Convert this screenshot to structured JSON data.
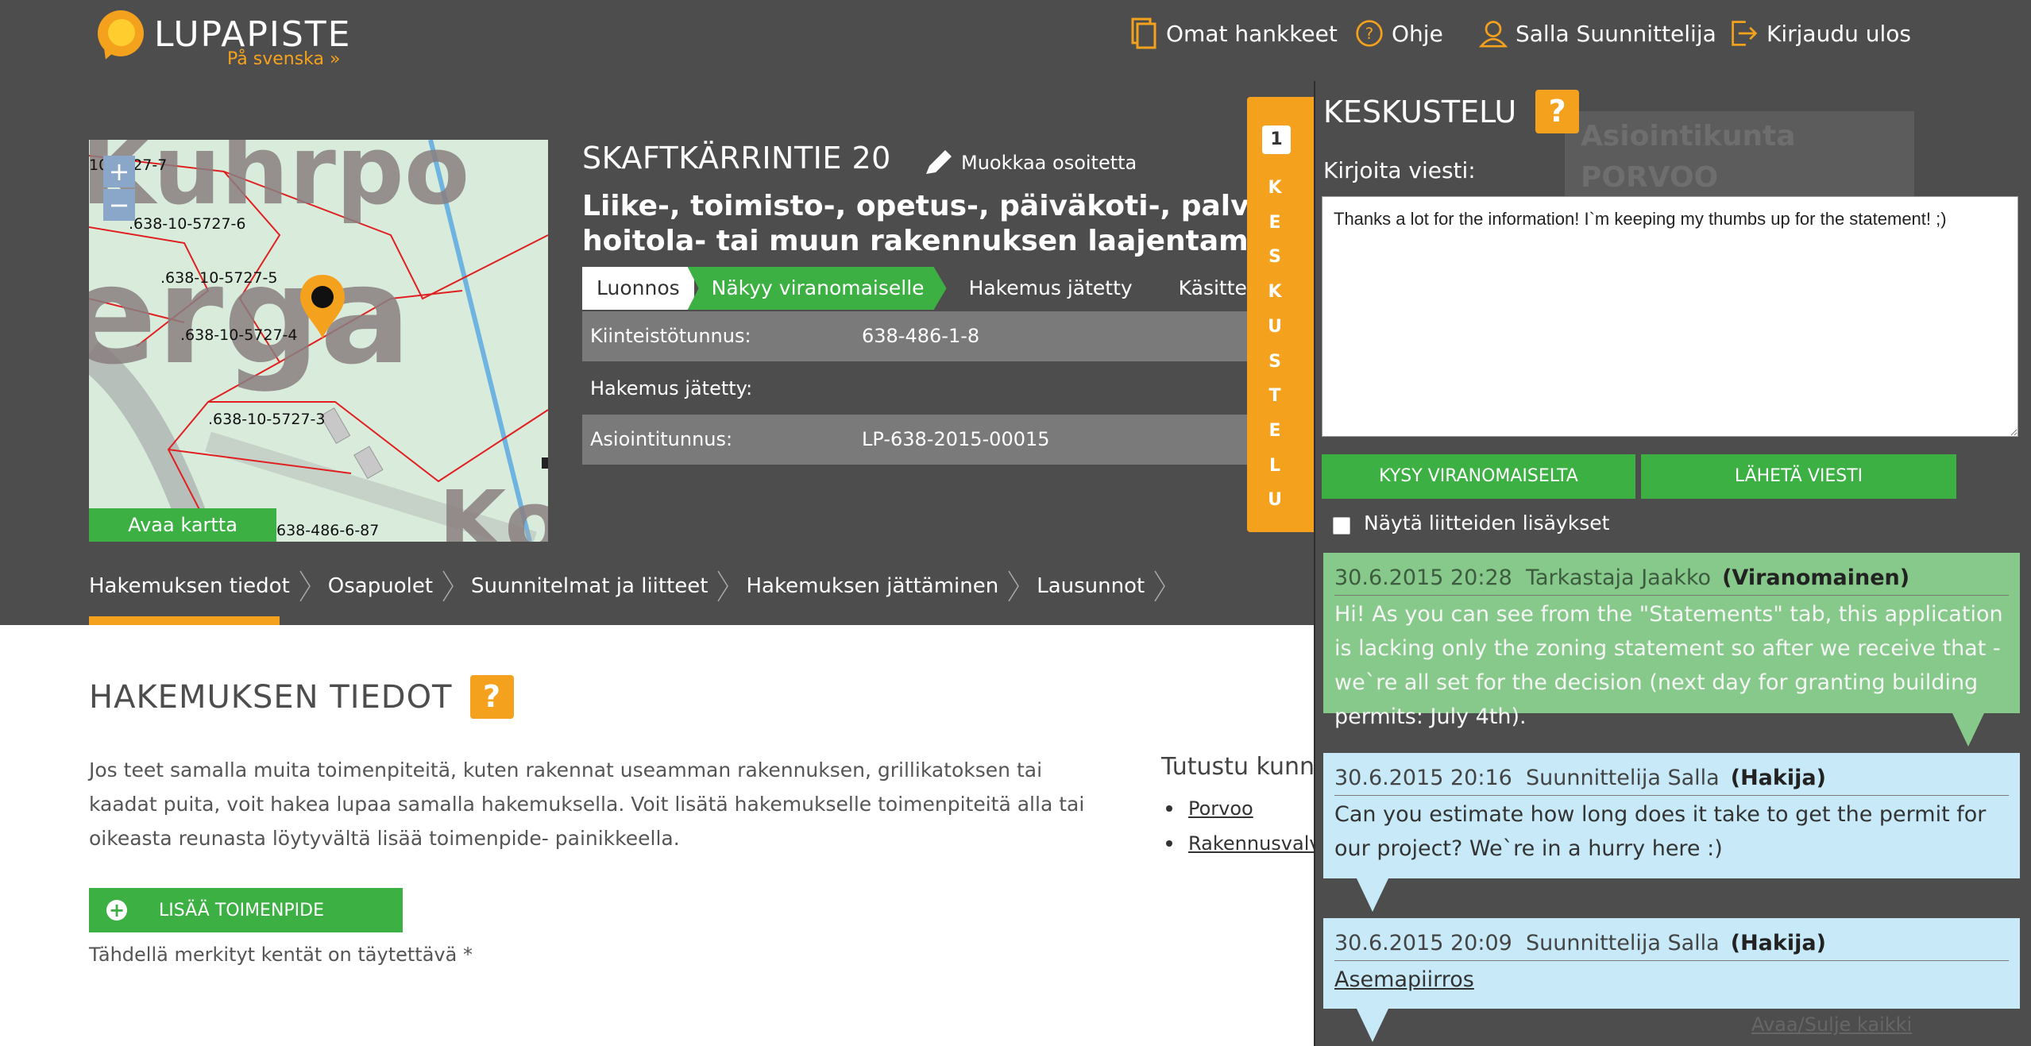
{
  "header": {
    "logo_text": "LUPAPISTE",
    "language_link": "På svenska »",
    "nav": [
      {
        "label": "Omat hankkeet",
        "icon": "document-icon"
      },
      {
        "label": "Ohje",
        "icon": "question-icon"
      },
      {
        "label": "Salla Suunnittelija",
        "icon": "user-icon"
      },
      {
        "label": "Kirjaudu ulos",
        "icon": "logout-icon"
      }
    ]
  },
  "map": {
    "open_label": "Avaa kartta",
    "zoom_in": "+",
    "zoom_out": "−",
    "parcel_labels": [
      "10-5727-7",
      ".638-10-5727-6",
      ".638-10-5727-5",
      ".638-10-5727-4",
      ".638-10-5727-3",
      "638-486-6-87"
    ],
    "background_text": [
      "Kuhrpo",
      "erga",
      "Ko"
    ]
  },
  "application": {
    "address": "SKAFTKÄRRINTIE 20",
    "edit_address": "Muokkaa osoitetta",
    "operation": "Liike-, toimisto-, opetus-, päiväkoti-, palvelu-, hoitola- tai muun rakennuksen laajentaminen",
    "steps": [
      "Luonnos",
      "Näkyy viranomaiselle",
      "Hakemus jätetty",
      "Käsittelyssä"
    ],
    "info": [
      {
        "label": "Kiinteistötunnus:",
        "value": "638-486-1-8"
      },
      {
        "label": "Hakemus jätetty:",
        "value": ""
      },
      {
        "label": "Asiointitunnus:",
        "value": "LP-638-2015-00015"
      }
    ]
  },
  "tabs": [
    "Hakemuksen tiedot",
    "Osapuolet",
    "Suunnitelmat ja liitteet",
    "Hakemuksen jättäminen",
    "Lausunnot"
  ],
  "main": {
    "title": "HAKEMUKSEN TIEDOT",
    "help": "?",
    "paragraph": "Jos teet samalla muita toimenpiteitä, kuten rakennat useamman rakennuksen, grillikatoksen tai kaadat puita, voit hakea lupaa samalla hakemuksella. Voit lisätä hakemukselle toimenpiteitä alla tai oikeasta reunasta löytyvältä lisää toimenpide- painikkeella.",
    "add_button": "LISÄÄ TOIMENPIDE",
    "required_note": "Tähdellä merkityt kentät on täytettävä *",
    "learn_title": "Tutustu kunna",
    "links": [
      "Porvoo",
      "Rakennusvalv"
    ]
  },
  "conversation": {
    "side_badge": "1",
    "side_letters": [
      "K",
      "E",
      "S",
      "K",
      "U",
      "S",
      "T",
      "E",
      "L",
      "U"
    ],
    "title": "KESKUSTELU",
    "help": "?",
    "ghost_text": [
      "Asiointikunta",
      "PORVOO"
    ],
    "write_label": "Kirjoita viesti:",
    "draft": "Thanks a lot for the information! I`m keeping my thumbs up for the statement! ;)",
    "ask_authority": "KYSY VIRANOMAISELTA",
    "send": "LÄHETÄ VIESTI",
    "show_attachments": "Näytä liitteiden lisäykset",
    "messages": [
      {
        "time": "30.6.2015 20:28",
        "author": "Tarkastaja Jaakko",
        "role": "(Viranomainen)",
        "text": "Hi! As you can see from the \"Statements\" tab, this application is lacking only the zoning statement so after we receive that - we`re all set for the decision (next day for granting building permits: July 4th)."
      },
      {
        "time": "30.6.2015 20:16",
        "author": "Suunnittelija Salla",
        "role": "(Hakija)",
        "text": "Can you estimate how long does it take to get the permit for our project? We`re in a hurry here :)"
      },
      {
        "time": "30.6.2015 20:09",
        "author": "Suunnittelija Salla",
        "role": "(Hakija)",
        "text": "Asemapiirros"
      }
    ],
    "toggle_all": "Avaa/Sulje kaikki"
  },
  "colors": {
    "header_bg": "#4d4d4d",
    "accent_orange": "#f4a21d",
    "accent_green": "#3cb043",
    "bubble_authority": "#86c98a",
    "bubble_applicant": "#c7e9f8"
  }
}
